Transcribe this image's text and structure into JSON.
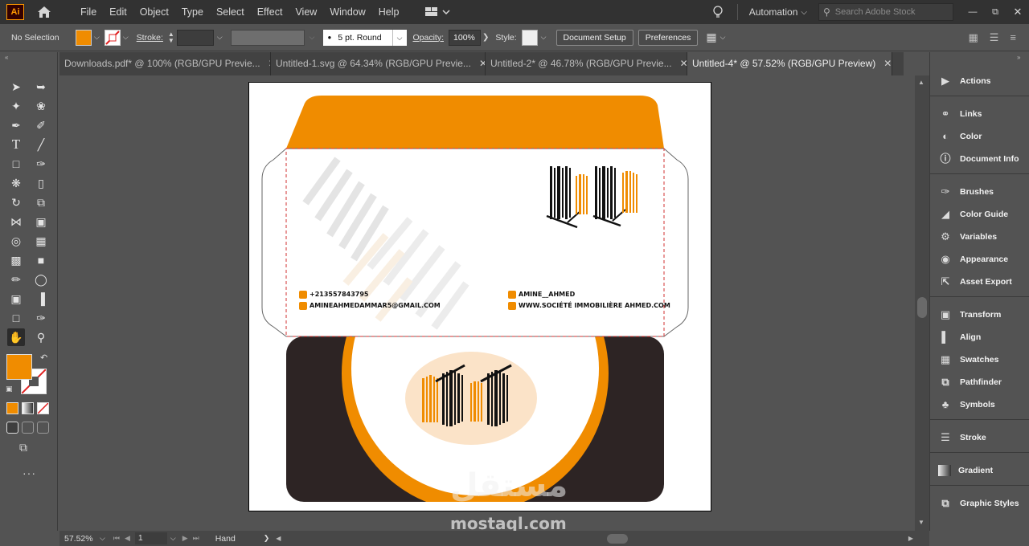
{
  "app": {
    "logo": "Ai"
  },
  "menu": [
    "File",
    "Edit",
    "Object",
    "Type",
    "Select",
    "Effect",
    "View",
    "Window",
    "Help"
  ],
  "top_right": {
    "workspace": "Automation",
    "search_placeholder": "Search Adobe Stock"
  },
  "control_bar": {
    "selection": "No Selection",
    "fill_color": "#f08c00",
    "stroke_label": "Stroke:",
    "brush": "5 pt. Round",
    "opacity_label": "Opacity:",
    "opacity_value": "100%",
    "style_label": "Style:",
    "document_setup": "Document Setup",
    "preferences": "Preferences"
  },
  "tabs": [
    {
      "label": "Downloads.pdf* @ 100% (RGB/GPU Previe...",
      "active": false
    },
    {
      "label": "Untitled-1.svg @ 64.34% (RGB/GPU Previe...",
      "active": false
    },
    {
      "label": "Untitled-2* @ 46.78% (RGB/GPU Previe...",
      "active": false
    },
    {
      "label": "Untitled-4* @ 57.52% (RGB/GPU Preview)",
      "active": true
    }
  ],
  "panels": [
    "Actions",
    "Links",
    "Color",
    "Document Info",
    "Brushes",
    "Color Guide",
    "Variables",
    "Appearance",
    "Asset Export",
    "Transform",
    "Align",
    "Swatches",
    "Pathfinder",
    "Symbols",
    "Stroke",
    "Gradient",
    "Graphic Styles"
  ],
  "artwork": {
    "phone": "+213557843795",
    "email": "AMINEAHMEDAMMAR5@GMAIL.COM",
    "name": "AMINE__AHMED",
    "website": "WWW.SOCIÉTÉ IMMOBILIÈRE AHMED.COM",
    "accent": "#f08c00",
    "dark": "#2d2424",
    "cream": "#fbe3c8"
  },
  "watermark": {
    "arabic": "مستقل",
    "latin": "mostaql.com"
  },
  "status": {
    "zoom": "57.52%",
    "artboard": "1",
    "tool": "Hand"
  }
}
